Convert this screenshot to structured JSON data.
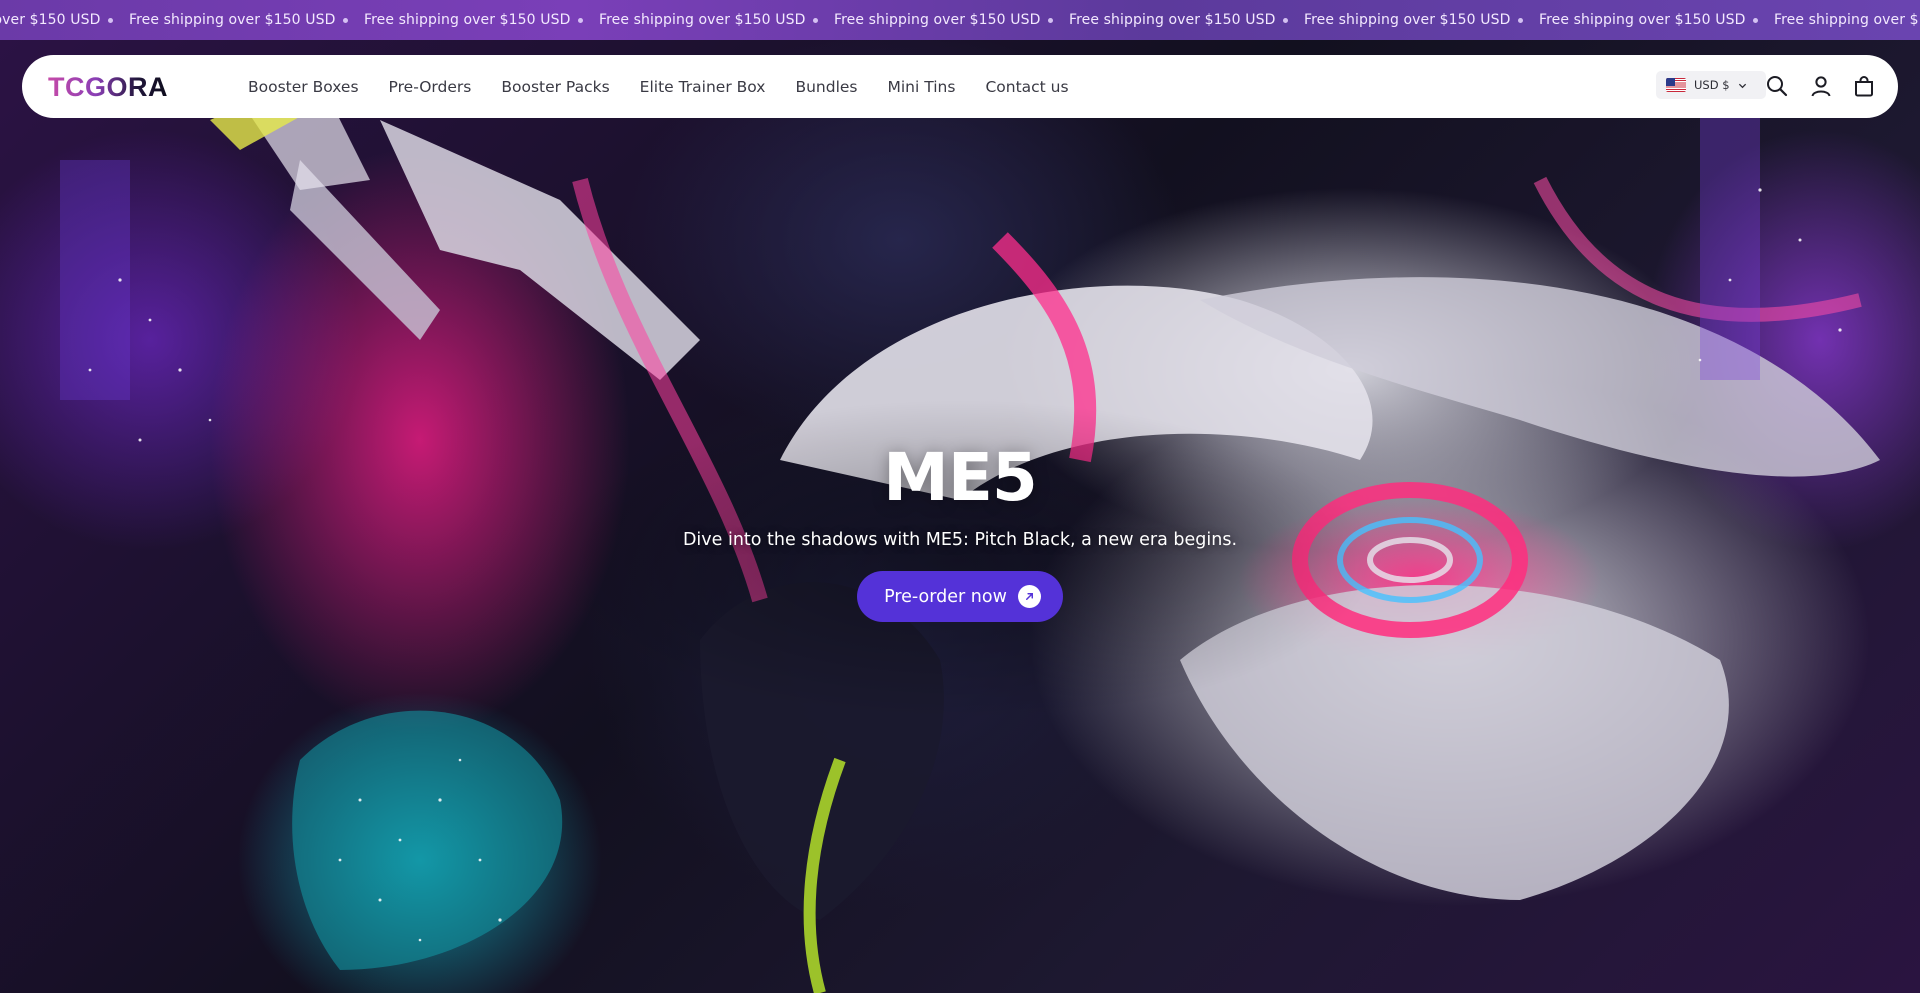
{
  "announcement": {
    "items": [
      "Free shipping over $150 USD",
      "Free shipping over $150 USD",
      "Free shipping over $150 USD",
      "Free shipping over $150 USD",
      "Free shipping over $150 USD",
      "Free shipping over $150 USD",
      "Free shipping over $150 USD",
      "Free shipping over $150 USD",
      "Free shipping over $150 USD"
    ]
  },
  "header": {
    "logo": "TCGORA",
    "nav": [
      "Booster Boxes",
      "Pre-Orders",
      "Booster Packs",
      "Elite Trainer Box",
      "Bundles",
      "Mini Tins",
      "Contact us"
    ],
    "currency": "USD $",
    "icons": [
      "search-icon",
      "account-icon",
      "cart-icon"
    ]
  },
  "hero": {
    "title": "ME5",
    "subtitle": "Dive into the shadows with ME5: Pitch Black, a new era begins.",
    "cta_label": "Pre-order now"
  },
  "colors": {
    "cta": "#5432d8",
    "announcement_bar": "#6b3aa8"
  }
}
